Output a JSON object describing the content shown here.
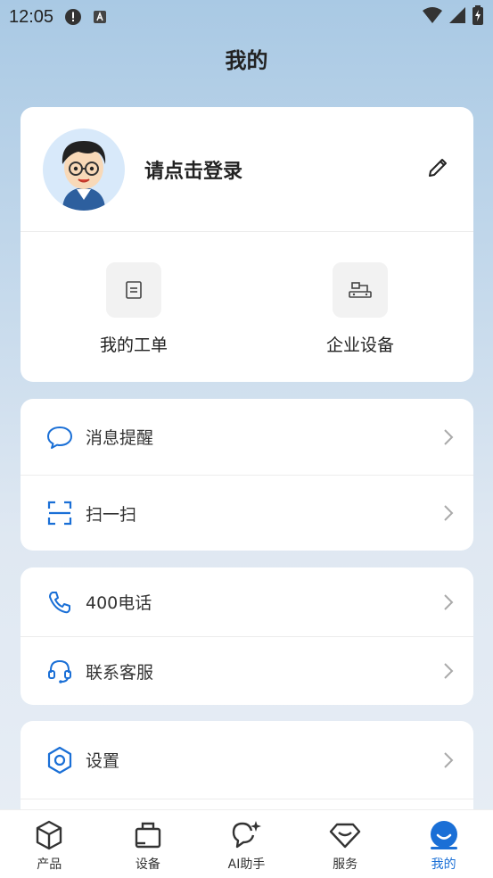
{
  "status": {
    "time": "12:05"
  },
  "page": {
    "title": "我的"
  },
  "profile": {
    "login_text": "请点击登录"
  },
  "quick_actions": [
    {
      "label": "我的工单",
      "icon": "document-icon"
    },
    {
      "label": "企业设备",
      "icon": "machine-icon"
    }
  ],
  "menu_group_1": [
    {
      "label": "消息提醒",
      "icon": "chat-bubble-icon"
    },
    {
      "label": "扫一扫",
      "icon": "scan-icon"
    }
  ],
  "menu_group_2": [
    {
      "label": "400电话",
      "icon": "phone-icon"
    },
    {
      "label": "联系客服",
      "icon": "headset-icon"
    }
  ],
  "menu_group_3": [
    {
      "label": "设置",
      "icon": "settings-hex-icon"
    }
  ],
  "tabs": [
    {
      "label": "产品",
      "icon": "cube-icon",
      "active": false
    },
    {
      "label": "设备",
      "icon": "device-bag-icon",
      "active": false
    },
    {
      "label": "AI助手",
      "icon": "ai-chat-icon",
      "active": false
    },
    {
      "label": "服务",
      "icon": "diamond-icon",
      "active": false
    },
    {
      "label": "我的",
      "icon": "smile-icon",
      "active": true
    }
  ],
  "colors": {
    "accent": "#1a6fd6",
    "text": "#222222",
    "divider": "#ececec"
  }
}
